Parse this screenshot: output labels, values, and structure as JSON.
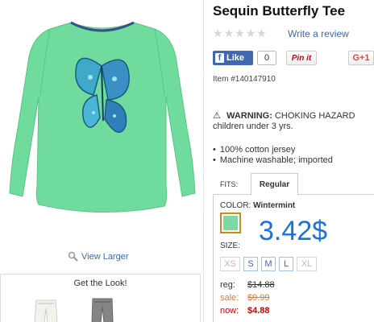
{
  "product": {
    "title": "Sequin Butterfly Tee",
    "write_review": "Write a review",
    "item_number": "Item #140147910",
    "rating_stars": 0,
    "rating_max": 5
  },
  "social": {
    "like_label": "Like",
    "like_count": "0",
    "pinit_label": "Pin it",
    "gplus_label": "G+1"
  },
  "warning": {
    "label": "WARNING:",
    "text": "CHOKING HAZARD",
    "line2": "children under 3 yrs."
  },
  "features": [
    "100% cotton jersey",
    "Machine washable; imported"
  ],
  "fits": {
    "label": "FITS:",
    "tabs": [
      "Regular"
    ]
  },
  "color": {
    "label": "COLOR:",
    "value": "Wintermint",
    "swatch": "#7ed8a2"
  },
  "price_overlay": "3.42$",
  "size": {
    "label": "SIZE:",
    "options": [
      {
        "label": "XS",
        "available": false
      },
      {
        "label": "S",
        "available": true
      },
      {
        "label": "M",
        "available": true
      },
      {
        "label": "L",
        "available": true
      },
      {
        "label": "XL",
        "available": false
      }
    ]
  },
  "prices": {
    "reg_label": "reg:",
    "reg_value": "$14.88",
    "sale_label": "sale:",
    "sale_value": "$9.99",
    "now_label": "now:",
    "now_value": "$4.88"
  },
  "gallery": {
    "view_larger": "View Larger",
    "get_the_look": "Get the Look!"
  },
  "colors": {
    "shirt": "#6fdb9c",
    "link": "#3b68b5",
    "price_blue": "#1a73d9",
    "now_red": "#cc0000",
    "sale_orange": "#e07b2e"
  }
}
